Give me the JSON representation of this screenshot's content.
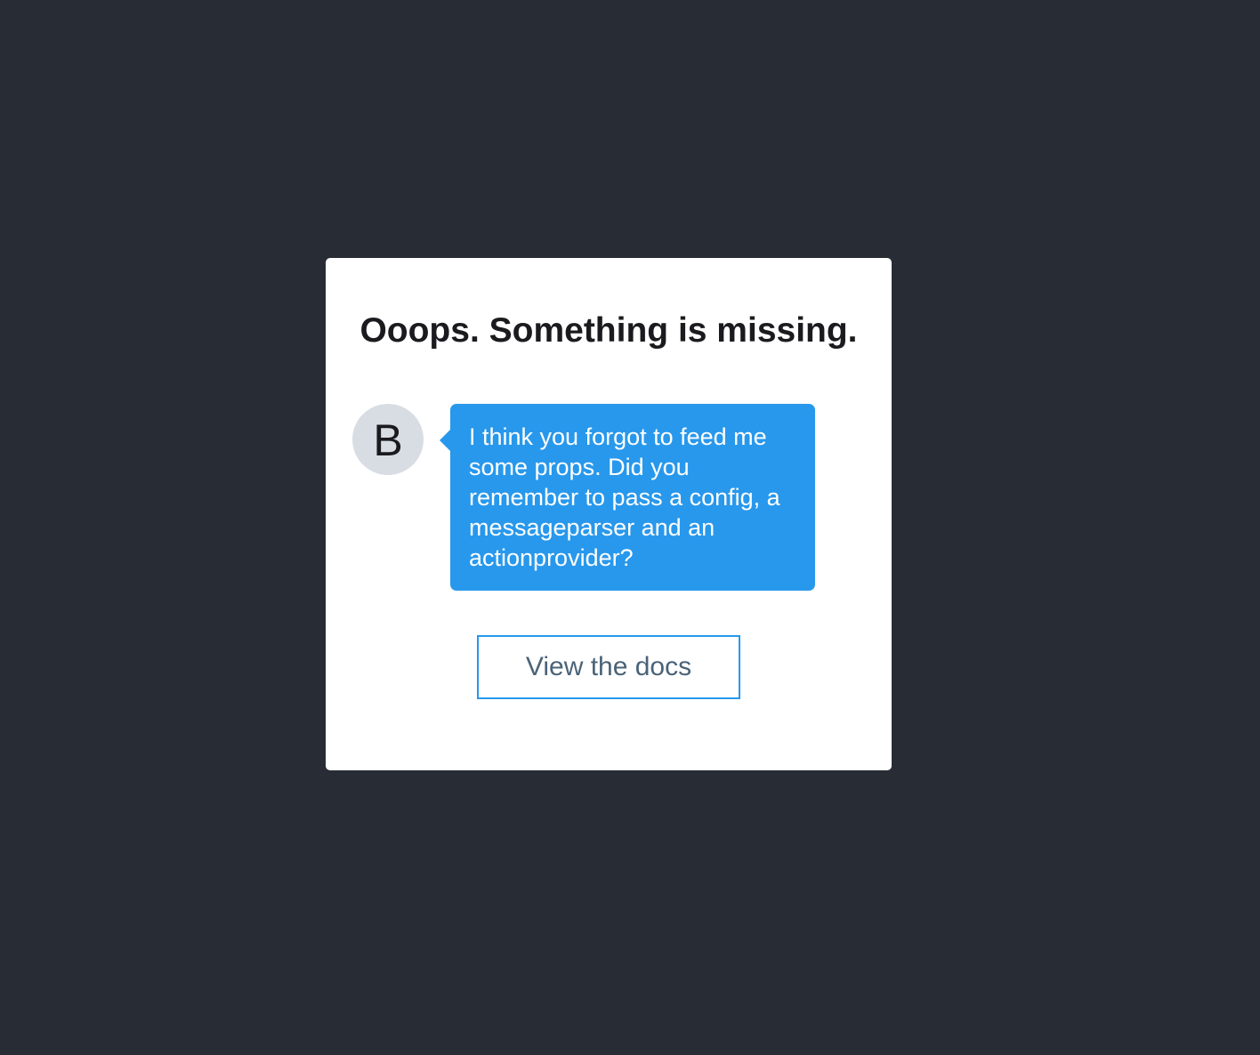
{
  "dialog": {
    "title": "Ooops. Something is missing."
  },
  "message": {
    "avatar_letter": "B",
    "text": "I think you forgot to feed me some props. Did you remember to pass a config, a messageparser and an actionprovider?"
  },
  "actions": {
    "docs_label": "View the docs"
  },
  "colors": {
    "background": "#282c35",
    "card": "#ffffff",
    "bubble": "#2898ec",
    "avatar": "#d8dde3",
    "button_border": "#2898ec",
    "button_text": "#4a6378",
    "title_text": "#1b1b1f"
  }
}
